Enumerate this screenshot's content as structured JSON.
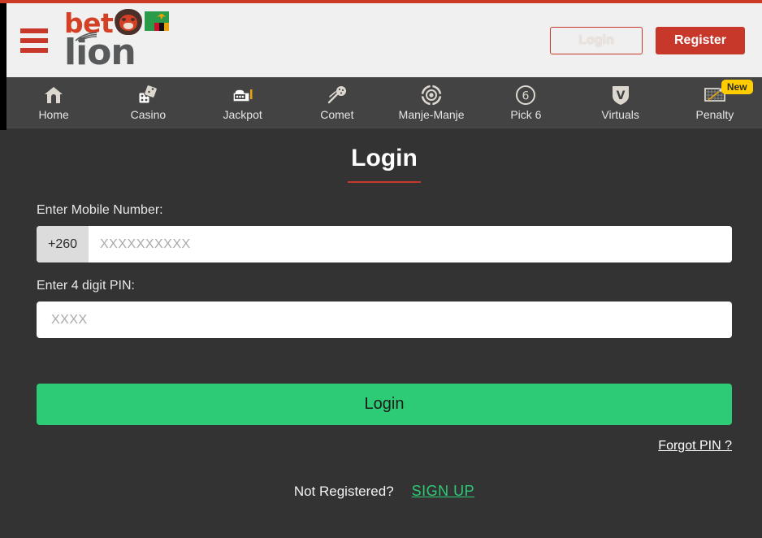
{
  "header": {
    "menu_icon": "hamburger-menu-icon",
    "logo": {
      "text_primary": "bet",
      "text_secondary": "lion",
      "mascot_icon": "lion-head-icon",
      "flag_icon": "zambia-flag-icon"
    },
    "login_label": "Login",
    "register_label": "Register",
    "accent_red": "#c7382a",
    "background": "#f0f0f0"
  },
  "nav": {
    "background": "#434343",
    "items": [
      {
        "label": "Home",
        "icon": "home-icon",
        "badge": null
      },
      {
        "label": "Casino",
        "icon": "dice-icon",
        "badge": null
      },
      {
        "label": "Jackpot",
        "icon": "slot-machine-icon",
        "badge": null
      },
      {
        "label": "Comet",
        "icon": "comet-icon",
        "badge": null
      },
      {
        "label": "Manje-Manje",
        "icon": "target-icon",
        "badge": null
      },
      {
        "label": "Pick 6",
        "icon": "circle-six-icon",
        "badge": null
      },
      {
        "label": "Virtuals",
        "icon": "v-shield-icon",
        "badge": null
      },
      {
        "label": "Penalty",
        "icon": "goal-net-icon",
        "badge": "New"
      }
    ],
    "badge_color": "#ffcc00"
  },
  "main": {
    "title": "Login",
    "background": "#333333",
    "mobile": {
      "label": "Enter Mobile Number:",
      "country_code": "+260",
      "placeholder": "XXXXXXXXXX",
      "value": ""
    },
    "pin": {
      "label": "Enter 4 digit PIN:",
      "placeholder": "XXXX",
      "value": ""
    },
    "submit_label": "Login",
    "submit_color": "#2ecb76",
    "forgot_label": "Forgot PIN ?",
    "signup_prompt": "Not Registered?",
    "signup_label": "SIGN UP",
    "signup_color": "#2ecb76"
  }
}
